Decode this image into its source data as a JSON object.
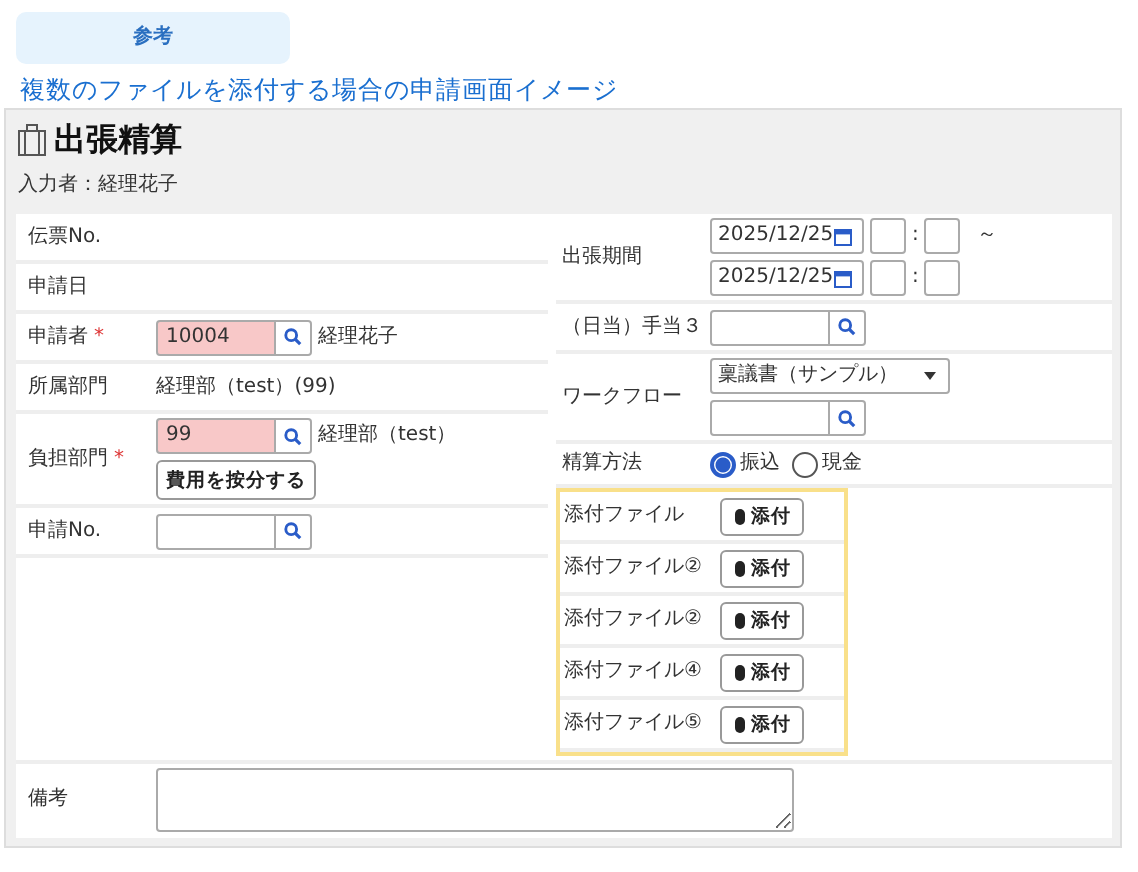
{
  "tab": {
    "label": "参考",
    "selected": true
  },
  "caption": "複数のファイルを添付する場合の申請画面イメージ",
  "form": {
    "title": "出張精算",
    "entered_by": "入力者：経理花子",
    "required_mark": "*",
    "left_rows": [
      {
        "kind": "text",
        "label": "伝票No.",
        "required": false
      },
      {
        "kind": "text",
        "label": "申請日",
        "required": false
      },
      {
        "kind": "lookup",
        "label": "申請者",
        "required": true,
        "value": "10004",
        "highlighted": true,
        "name": "経理花子"
      },
      {
        "kind": "text",
        "label": "所属部門",
        "required": false,
        "value": "経理部（test）(99)"
      },
      {
        "kind": "lookup",
        "label": "負担部門",
        "required": true,
        "value": "99",
        "highlighted": true,
        "name": "経理部（test）",
        "button": "費用を按分する"
      },
      {
        "kind": "lookup",
        "label": "申請No.",
        "required": false,
        "highlighted": false
      }
    ],
    "period": {
      "label": "出張期間",
      "separator": ":",
      "tilde": "～",
      "dates": [
        "2025/12/25",
        "2025/12/25"
      ]
    },
    "allowance": {
      "label": "（日当）手当３"
    },
    "workflow": {
      "label": "ワークフロー",
      "value": "稟議書（サンプル）"
    },
    "method": {
      "label": "精算方法",
      "options": [
        {
          "label": "振込",
          "selected": true
        },
        {
          "label": "現金",
          "selected": false
        }
      ]
    },
    "attachments": {
      "highlighted": true,
      "rows": [
        {
          "label": "添付ファイル",
          "button": "添付"
        },
        {
          "label": "添付ファイル②",
          "button": "添付"
        },
        {
          "label": "添付ファイル②",
          "button": "添付"
        },
        {
          "label": "添付ファイル④",
          "button": "添付"
        },
        {
          "label": "添付ファイル⑤",
          "button": "添付"
        }
      ]
    },
    "remarks": {
      "label": "備考"
    }
  }
}
